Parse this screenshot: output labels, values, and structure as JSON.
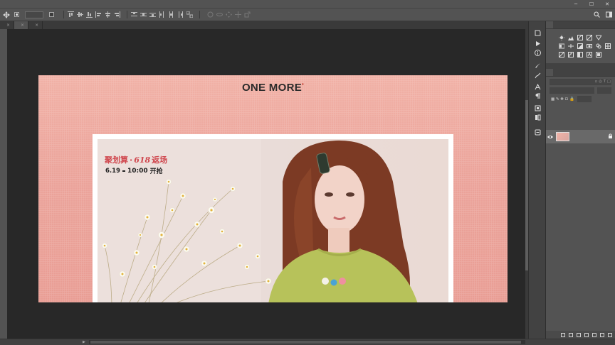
{
  "menu": [
    "",
    "",
    "",
    "",
    "",
    "",
    "",
    "",
    "",
    "",
    "",
    ""
  ],
  "options": {
    "auto_select_label": "",
    "auto_select_value": "",
    "show_transform_label": "",
    "mode_3d_label": ""
  },
  "tabs": [
    {
      "label": ""
    },
    {
      "label": ""
    },
    {
      "label": ""
    }
  ],
  "canvas": {
    "brand": "ONE MORE",
    "brand_mark": "*",
    "nav_items": [
      "",
      "",
      "",
      "",
      "",
      "",
      "",
      "",
      "",
      "",
      ""
    ],
    "banner": {
      "title_part1": "聚划算",
      "title_618": "618",
      "title_part2": "返场",
      "date": "6.19",
      "weekday": "",
      "time": "10:00",
      "time_suffix": "开抢"
    }
  },
  "panels": {
    "adjust_tabs": [
      ""
    ],
    "adjust_title": "",
    "layers_tabs": [
      "",
      "",
      ""
    ],
    "kind_placeholder": "",
    "blend_mode": "",
    "opacity_label": "",
    "opacity_value": "",
    "lock_label": "",
    "fill_label": "",
    "fill_value": "",
    "layer_name": ""
  },
  "status": {
    "zoom": "",
    "doc": ""
  },
  "colors": {
    "accent_red": "#d0484f",
    "canvas_pink": "#eda49b",
    "ui_gray": "#535353"
  }
}
